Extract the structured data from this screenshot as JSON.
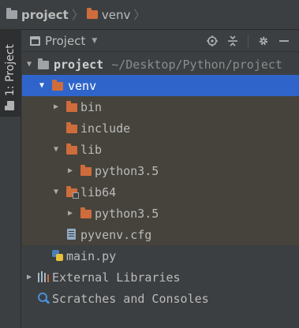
{
  "breadcrumb": {
    "items": [
      {
        "label": "project",
        "icon": "folder-icon"
      },
      {
        "label": "venv",
        "icon": "folder-icon"
      }
    ],
    "separator": "〉"
  },
  "stripe": {
    "tab_label": "1: Project"
  },
  "panel": {
    "view_label": "Project",
    "actions": [
      "locate-icon",
      "collapse-all-icon",
      "settings-icon",
      "hide-icon"
    ]
  },
  "tree": {
    "project": {
      "label": "project",
      "path": "~/Desktop/Python/project"
    },
    "venv": {
      "label": "venv"
    },
    "bin": {
      "label": "bin"
    },
    "include": {
      "label": "include"
    },
    "lib": {
      "label": "lib"
    },
    "lib_python": {
      "label": "python3.5"
    },
    "lib64": {
      "label": "lib64"
    },
    "lib64_python": {
      "label": "python3.5"
    },
    "pyvenv": {
      "label": "pyvenv.cfg"
    },
    "main": {
      "label": "main.py"
    },
    "external": {
      "label": "External Libraries"
    },
    "scratches": {
      "label": "Scratches and Consoles"
    }
  },
  "colors": {
    "background": "#3c3f41",
    "selection": "#2f65ca",
    "venv_highlight": "#45433b",
    "folder_orange": "#cf6c3c"
  }
}
